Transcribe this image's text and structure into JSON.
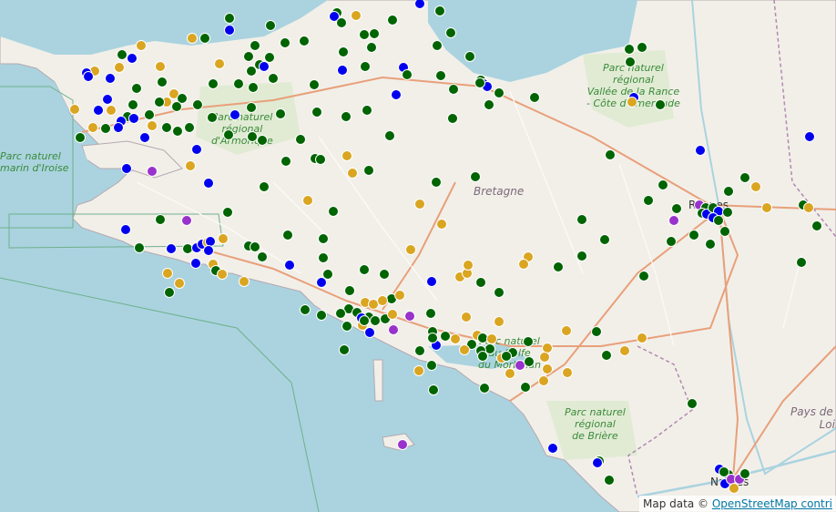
{
  "labels": {
    "park_iroise": "Parc naturel\nmarin d'Iroise",
    "park_armorique": "Parc naturel\nrégional\nd'Armorique",
    "park_rance": "Parc naturel\nrégional\nVallée de la Rance\n- Côte d'Émeraude",
    "park_morbihan": "Parc naturel\ndu Golfe\ndu Morbihan",
    "park_briere": "Parc naturel\nrégional\nde Brière",
    "region_bretagne": "Bretagne",
    "city_rennes": "Rennes",
    "city_nantes": "Nantes",
    "pays_loire": "Pays de la\nLoire"
  },
  "attribution": {
    "prefix": "Map data © ",
    "link": "OpenStreetMap contri"
  },
  "colors": {
    "green": "#006400",
    "blue": "#0000ee",
    "gold": "#daa520",
    "purple": "#9932cc"
  }
}
